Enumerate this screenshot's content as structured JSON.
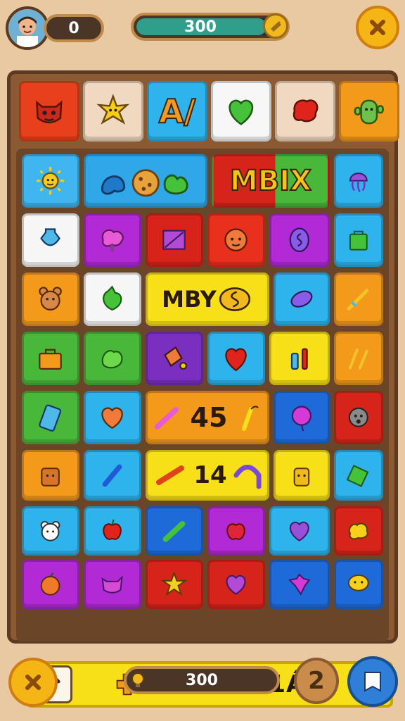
{
  "hud": {
    "score": "0",
    "progress_value": "300",
    "progress_fraction": 0.88,
    "bottom_value": "300",
    "help_label": "2"
  },
  "icons": {
    "avatar": "player-avatar",
    "coin": "coin-icon",
    "close": "close-x-icon",
    "bulb": "lightbulb-icon",
    "help": "help-number-button",
    "book": "book-icon",
    "arrow": "up-arrow-icon"
  },
  "top_row": [
    {
      "icon": "devil-face",
      "color": "#e8401c"
    },
    {
      "icon": "sun-star-face",
      "color": "#f0d9c0"
    },
    {
      "icon": "text",
      "text": "A/",
      "color": "#2fb3ec"
    },
    {
      "icon": "green-heart",
      "color": "#f7f7f7"
    },
    {
      "icon": "red-blob",
      "color": "#f0d9c0"
    },
    {
      "icon": "green-cactus",
      "color": "#f39a1b"
    }
  ],
  "grid_texts": {
    "mbix": "MBIX",
    "mbys": "MBY",
    "num45": "45",
    "num14": "14"
  },
  "bottom_bar": {
    "text": "PDUN 341Á"
  },
  "colors": {
    "background": "#e9c9a2",
    "board": "#8b5a33",
    "yellow": "#f7e017",
    "blue": "#2f7fd9"
  }
}
